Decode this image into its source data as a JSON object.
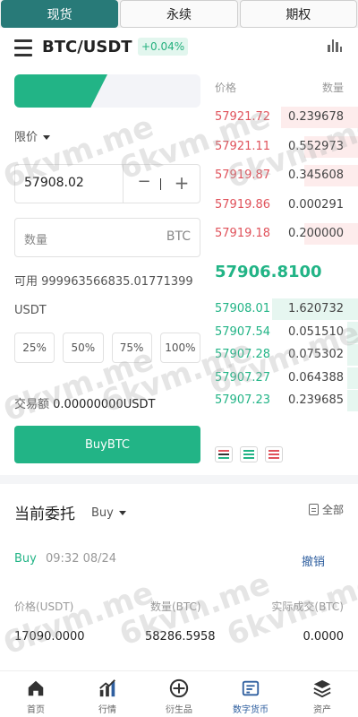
{
  "top_tabs": [
    {
      "label": "现货",
      "active": true
    },
    {
      "label": "永续",
      "active": false
    },
    {
      "label": "期权",
      "active": false
    }
  ],
  "header": {
    "pair": "BTC/USDT",
    "change": "+0.04%",
    "menu_icon": "hamburger-menu-icon",
    "chart_icon": "bar-chart-icon"
  },
  "form": {
    "buy_tab": "",
    "sell_tab": "",
    "order_type": "限价",
    "price_value": "57908.02",
    "minus": "−",
    "plus": "+",
    "qty_placeholder": "数量",
    "qty_unit": "BTC",
    "available": "可用 999963566835.01771399 USDT",
    "pcts": [
      "25%",
      "50%",
      "75%",
      "100%"
    ],
    "amount_label": "交易额",
    "amount_value": "0.00000000USDT",
    "buy_button": "BuyBTC"
  },
  "orderbook": {
    "price_header": "价格",
    "qty_header": "数量",
    "asks": [
      {
        "price": "57921.72",
        "qty": "0.239678",
        "depth": 0.9
      },
      {
        "price": "57921.11",
        "qty": "0.552973",
        "depth": 0.62
      },
      {
        "price": "57919.87",
        "qty": "0.345608",
        "depth": 0.62
      },
      {
        "price": "57919.86",
        "qty": "0.000291",
        "depth": 0.0
      },
      {
        "price": "57919.18",
        "qty": "0.200000",
        "depth": 0.62
      }
    ],
    "last_price": "57906.8100",
    "bids": [
      {
        "price": "57908.01",
        "qty": "1.620732",
        "depth": 1.0
      },
      {
        "price": "57907.54",
        "qty": "0.051510",
        "depth": 0.12
      },
      {
        "price": "57907.28",
        "qty": "0.075302",
        "depth": 0.12
      },
      {
        "price": "57907.27",
        "qty": "0.064388",
        "depth": 0.12
      },
      {
        "price": "57907.23",
        "qty": "0.239685",
        "depth": 0.12
      }
    ]
  },
  "orders": {
    "title": "当前委托",
    "filter": "Buy",
    "all_link": "全部",
    "item": {
      "side": "Buy",
      "time": "09:32 08/24",
      "cancel": "撤销",
      "price_header": "价格(USDT)",
      "qty_header": "数量(BTC)",
      "filled_header": "实际成交(BTC)",
      "price": "17090.0000",
      "qty": "58286.5958",
      "filled": "0.0000"
    }
  },
  "bottom_nav": [
    {
      "label": "首页",
      "icon": "home-icon",
      "active": false
    },
    {
      "label": "行情",
      "icon": "market-chart-icon",
      "active": false
    },
    {
      "label": "衍生品",
      "icon": "derivatives-icon",
      "active": false
    },
    {
      "label": "数字货币",
      "icon": "crypto-trade-icon",
      "active": true
    },
    {
      "label": "资产",
      "icon": "assets-layers-icon",
      "active": false
    }
  ],
  "watermark": "6kvm.me",
  "colors": {
    "green": "#22b486",
    "red": "#e0525b",
    "tab_active": "#287a78",
    "link_blue": "#2f5f9f"
  }
}
